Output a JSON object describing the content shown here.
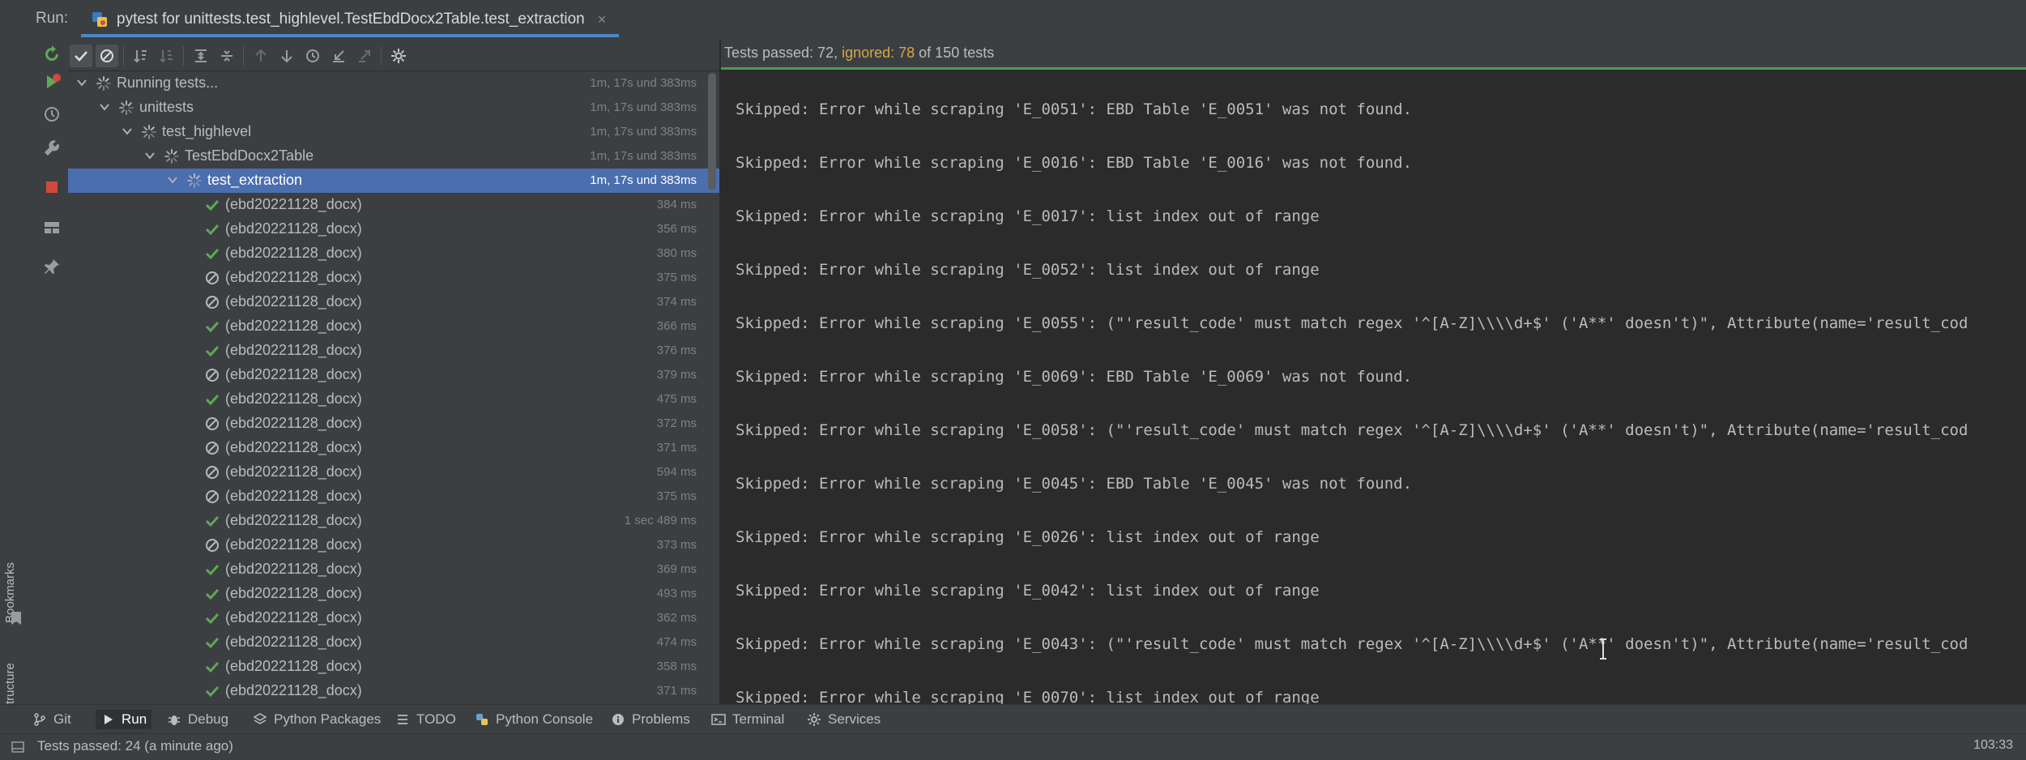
{
  "header": {
    "run_label": "Run:",
    "tab_title": "pytest for unittests.test_highlevel.TestEbdDocx2Table.test_extraction",
    "close_glyph": "×"
  },
  "side_labels": {
    "bookmarks": "Bookmarks",
    "structure": "Structure"
  },
  "status": {
    "passed": "Tests passed: 72, ",
    "ignored": "ignored: 78",
    "total": " of 150 tests"
  },
  "tree": {
    "nodes": [
      {
        "label": "Running tests...",
        "duration": "1m, 17s und 383ms"
      },
      {
        "label": "unittests",
        "duration": "1m, 17s und 383ms"
      },
      {
        "label": "test_highlevel",
        "duration": "1m, 17s und 383ms"
      },
      {
        "label": "TestEbdDocx2Table",
        "duration": "1m, 17s und 383ms"
      },
      {
        "label": "test_extraction",
        "duration": "1m, 17s und 383ms"
      }
    ],
    "items": [
      {
        "label": "(ebd20221128_docx)",
        "duration": "384 ms",
        "status": "passed"
      },
      {
        "label": "(ebd20221128_docx)",
        "duration": "356 ms",
        "status": "passed"
      },
      {
        "label": "(ebd20221128_docx)",
        "duration": "380 ms",
        "status": "passed"
      },
      {
        "label": "(ebd20221128_docx)",
        "duration": "375 ms",
        "status": "ignored"
      },
      {
        "label": "(ebd20221128_docx)",
        "duration": "374 ms",
        "status": "ignored"
      },
      {
        "label": "(ebd20221128_docx)",
        "duration": "366 ms",
        "status": "passed"
      },
      {
        "label": "(ebd20221128_docx)",
        "duration": "376 ms",
        "status": "passed"
      },
      {
        "label": "(ebd20221128_docx)",
        "duration": "379 ms",
        "status": "ignored"
      },
      {
        "label": "(ebd20221128_docx)",
        "duration": "475 ms",
        "status": "passed"
      },
      {
        "label": "(ebd20221128_docx)",
        "duration": "372 ms",
        "status": "ignored"
      },
      {
        "label": "(ebd20221128_docx)",
        "duration": "371 ms",
        "status": "ignored"
      },
      {
        "label": "(ebd20221128_docx)",
        "duration": "594 ms",
        "status": "ignored"
      },
      {
        "label": "(ebd20221128_docx)",
        "duration": "375 ms",
        "status": "ignored"
      },
      {
        "label": "(ebd20221128_docx)",
        "duration": "1 sec 489 ms",
        "status": "passed"
      },
      {
        "label": "(ebd20221128_docx)",
        "duration": "373 ms",
        "status": "ignored"
      },
      {
        "label": "(ebd20221128_docx)",
        "duration": "369 ms",
        "status": "passed"
      },
      {
        "label": "(ebd20221128_docx)",
        "duration": "493 ms",
        "status": "passed"
      },
      {
        "label": "(ebd20221128_docx)",
        "duration": "362 ms",
        "status": "passed"
      },
      {
        "label": "(ebd20221128_docx)",
        "duration": "474 ms",
        "status": "passed"
      },
      {
        "label": "(ebd20221128_docx)",
        "duration": "358 ms",
        "status": "passed"
      },
      {
        "label": "(ebd20221128_docx)",
        "duration": "371 ms",
        "status": "passed"
      }
    ]
  },
  "console": {
    "lines": [
      "Skipped: Error while scraping 'E_0051': EBD Table 'E_0051' was not found.",
      "Skipped: Error while scraping 'E_0016': EBD Table 'E_0016' was not found.",
      "Skipped: Error while scraping 'E_0017': list index out of range",
      "Skipped: Error while scraping 'E_0052': list index out of range",
      "Skipped: Error while scraping 'E_0055': (\"'result_code' must match regex '^[A-Z]\\\\\\\\d+$' ('A**' doesn't)\", Attribute(name='result_cod",
      "Skipped: Error while scraping 'E_0069': EBD Table 'E_0069' was not found.",
      "Skipped: Error while scraping 'E_0058': (\"'result_code' must match regex '^[A-Z]\\\\\\\\d+$' ('A**' doesn't)\", Attribute(name='result_cod",
      "Skipped: Error while scraping 'E_0045': EBD Table 'E_0045' was not found.",
      "Skipped: Error while scraping 'E_0026': list index out of range",
      "Skipped: Error while scraping 'E_0042': list index out of range",
      "Skipped: Error while scraping 'E_0043': (\"'result_code' must match regex '^[A-Z]\\\\\\\\d+$' ('A**' doesn't)\", Attribute(name='result_cod",
      "Skipped: Error while scraping 'E_0070': list index out of range"
    ]
  },
  "bottom_tools": [
    {
      "label": "Git",
      "icon": "git-branch-icon"
    },
    {
      "label": "Run",
      "icon": "run-icon"
    },
    {
      "label": "Debug",
      "icon": "bug-icon"
    },
    {
      "label": "Python Packages",
      "icon": "layers-icon"
    },
    {
      "label": "TODO",
      "icon": "list-icon"
    },
    {
      "label": "Python Console",
      "icon": "python-icon"
    },
    {
      "label": "Problems",
      "icon": "info-icon"
    },
    {
      "label": "Terminal",
      "icon": "terminal-icon"
    },
    {
      "label": "Services",
      "icon": "gear-icon"
    }
  ],
  "statusbar": {
    "message": "Tests passed: 24 (a minute ago)",
    "time": "103:33"
  },
  "colors": {
    "accent": "#4a88c7",
    "selected_row": "#4b6eaf",
    "passed": "#5fa956",
    "ignored_text": "#d6a648",
    "progress": "#499c54"
  }
}
